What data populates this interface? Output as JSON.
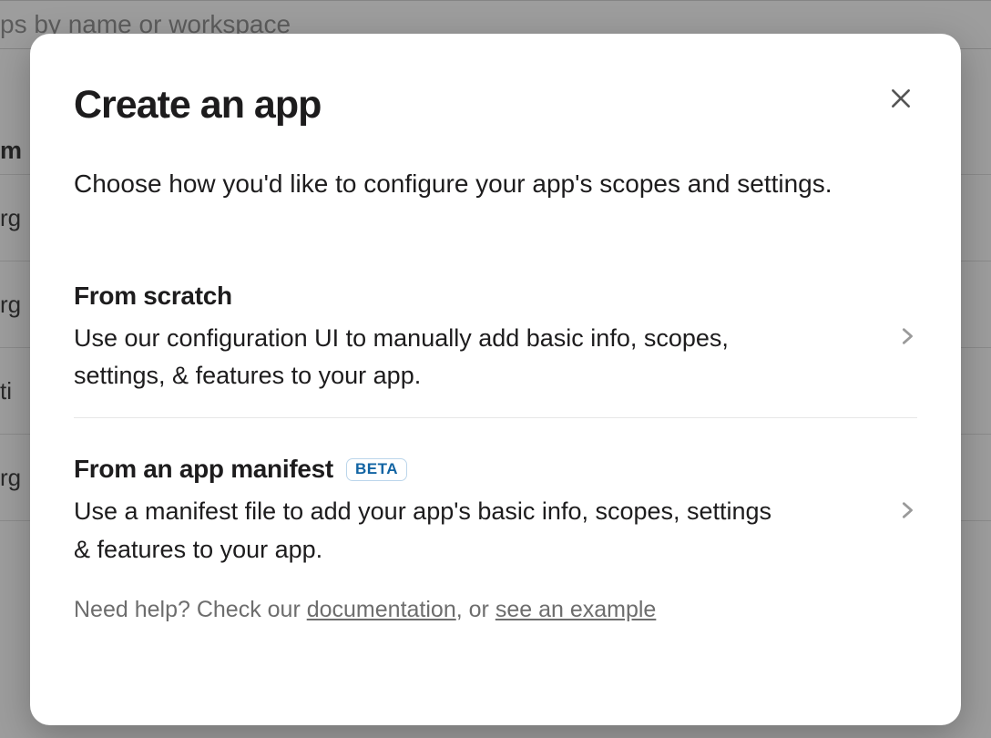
{
  "background": {
    "search_fragment": "ps by name or workspace",
    "row_fragments": [
      "m",
      "rg",
      "rg",
      "ti",
      "rg"
    ]
  },
  "modal": {
    "title": "Create an app",
    "subtitle": "Choose how you'd like to configure your app's scopes and settings.",
    "options": [
      {
        "title": "From scratch",
        "description": "Use our configuration UI to manually add basic info, scopes, settings, & features to your app.",
        "badge": null
      },
      {
        "title": "From an app manifest",
        "description": "Use a manifest file to add your app's basic info, scopes, settings & features to your app.",
        "badge": "BETA"
      }
    ],
    "help": {
      "prefix": "Need help? Check our ",
      "doc_link": "documentation",
      "mid": ", or ",
      "example_link": "see an example"
    }
  }
}
